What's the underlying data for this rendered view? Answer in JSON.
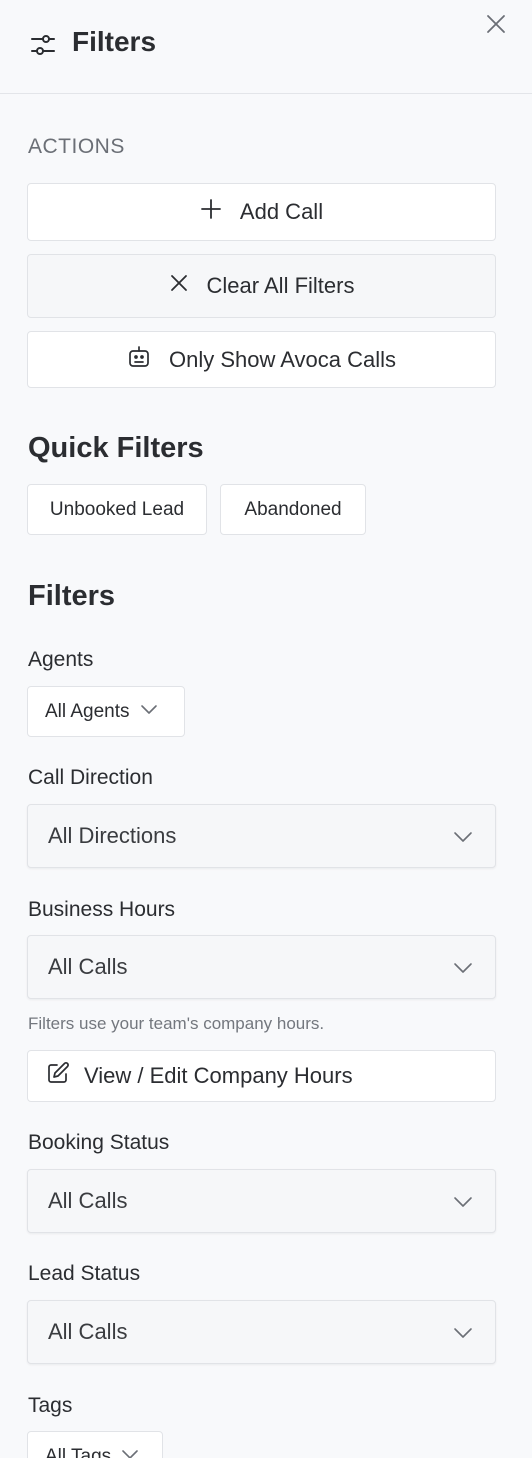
{
  "header": {
    "title": "Filters"
  },
  "actions": {
    "label": "ACTIONS",
    "add_call": "Add Call",
    "clear_filters": "Clear All Filters",
    "only_avoca": "Only Show Avoca Calls"
  },
  "quick_filters": {
    "title": "Quick Filters",
    "items": [
      "Unbooked Lead",
      "Abandoned"
    ]
  },
  "filters": {
    "title": "Filters",
    "agents": {
      "label": "Agents",
      "value": "All Agents"
    },
    "call_direction": {
      "label": "Call Direction",
      "value": "All Directions"
    },
    "business_hours": {
      "label": "Business Hours",
      "value": "All Calls",
      "hint": "Filters use your team's company hours.",
      "edit_label": "View / Edit Company Hours"
    },
    "booking_status": {
      "label": "Booking Status",
      "value": "All Calls"
    },
    "lead_status": {
      "label": "Lead Status",
      "value": "All Calls"
    },
    "tags": {
      "label": "Tags",
      "value": "All Tags"
    }
  }
}
